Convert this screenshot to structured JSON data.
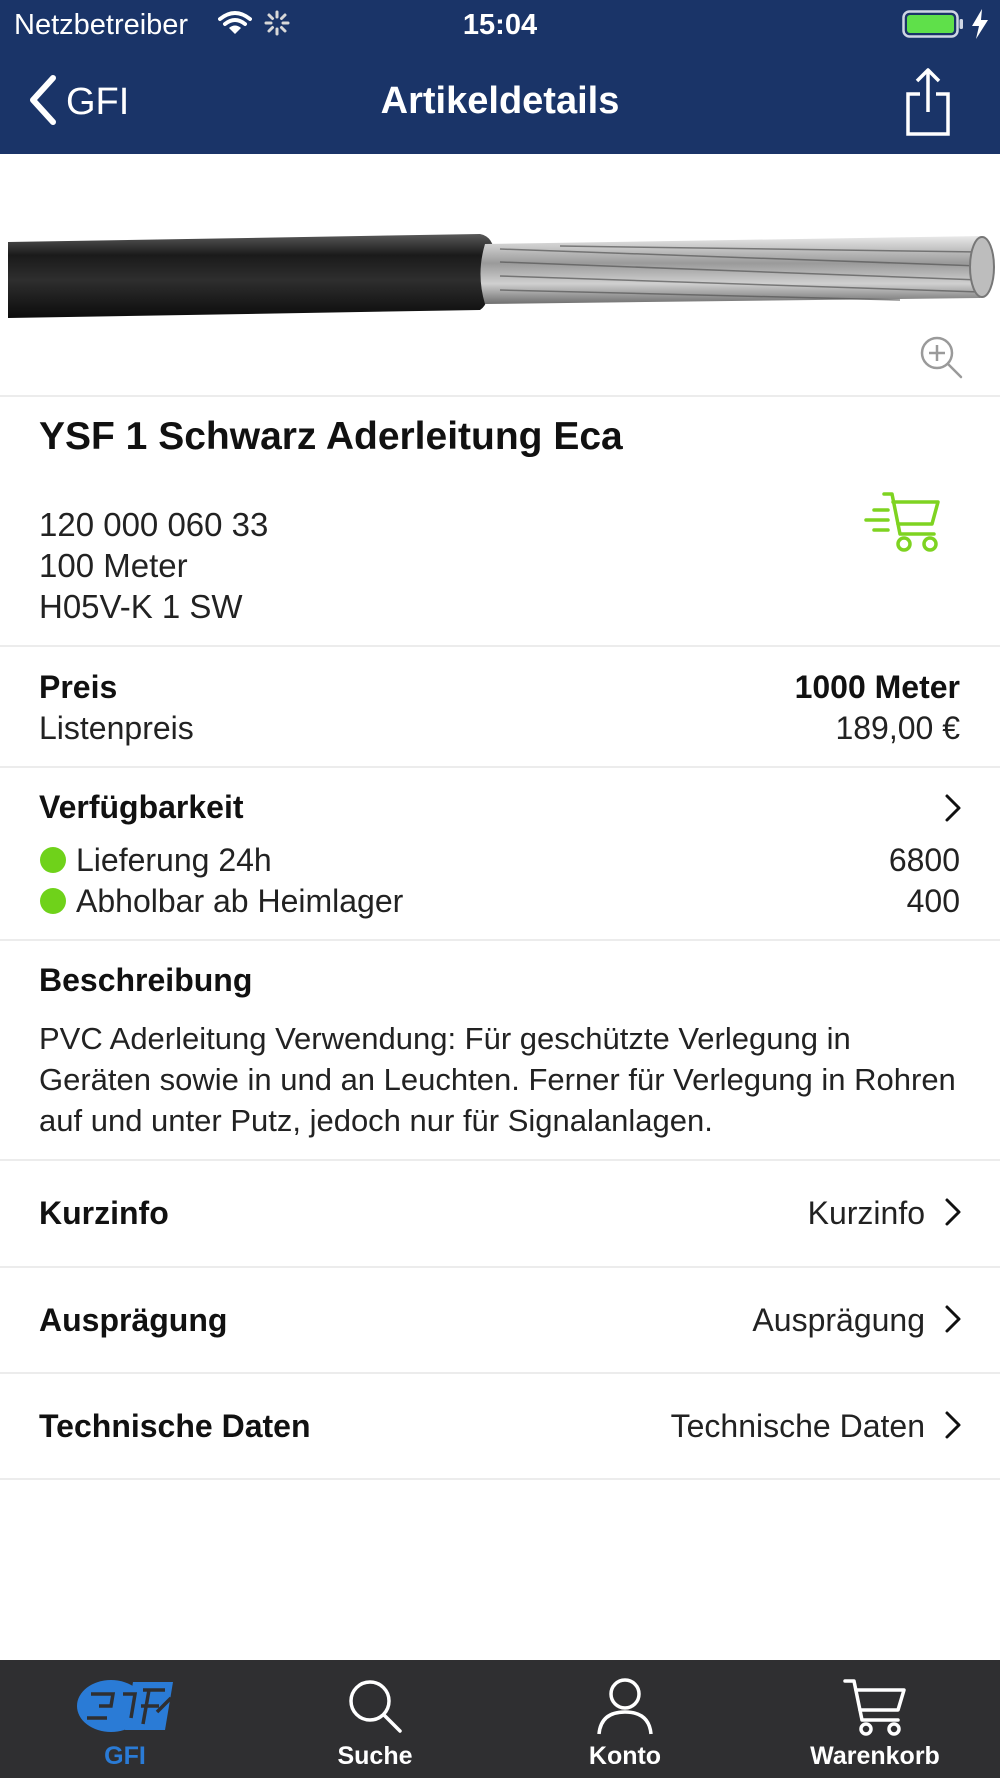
{
  "status_bar": {
    "carrier": "Netzbetreiber",
    "time": "15:04",
    "icons": [
      "wifi-icon",
      "activity-spinner-icon",
      "battery-icon",
      "charging-bolt-icon"
    ]
  },
  "nav": {
    "back_label": "GFI",
    "title": "Artikeldetails",
    "share_icon": "share-icon"
  },
  "product": {
    "title": "YSF 1 Schwarz Aderleitung Eca",
    "article_number": "120 000 060 33",
    "pack_unit": "100 Meter",
    "type_code": "H05V-K 1 SW"
  },
  "price": {
    "label": "Preis",
    "unit": "1000 Meter",
    "list_label": "Listenpreis",
    "list_value": "189,00 €"
  },
  "availability": {
    "label": "Verfügbarkeit",
    "items": [
      {
        "label": "Lieferung 24h",
        "value": "6800",
        "status_color": "#6fd21a"
      },
      {
        "label": "Abholbar ab Heimlager",
        "value": "400",
        "status_color": "#6fd21a"
      }
    ]
  },
  "description": {
    "label": "Beschreibung",
    "text": "PVC  Aderleitung  Verwendung: Für geschützte Verlegung in Geräten sowie in und an Leuchten. Ferner für Verlegung in Rohren auf und unter Putz, jedoch nur für Signalanlagen."
  },
  "links": [
    {
      "label": "Kurzinfo",
      "value": "Kurzinfo"
    },
    {
      "label": "Ausprägung",
      "value": "Ausprägung"
    },
    {
      "label": "Technische Daten",
      "value": "Technische Daten"
    }
  ],
  "tabs": [
    {
      "label": "GFI",
      "icon": "gfi-logo-icon",
      "active": true
    },
    {
      "label": "Suche",
      "icon": "search-icon",
      "active": false
    },
    {
      "label": "Konto",
      "icon": "user-icon",
      "active": false
    },
    {
      "label": "Warenkorb",
      "icon": "cart-icon",
      "active": false
    }
  ],
  "colors": {
    "header": "#1a3468",
    "tabbar": "#2f2f31",
    "accent_blue": "#2a7bd6",
    "cart_green": "#7ed321",
    "status_green": "#6fd21a"
  }
}
